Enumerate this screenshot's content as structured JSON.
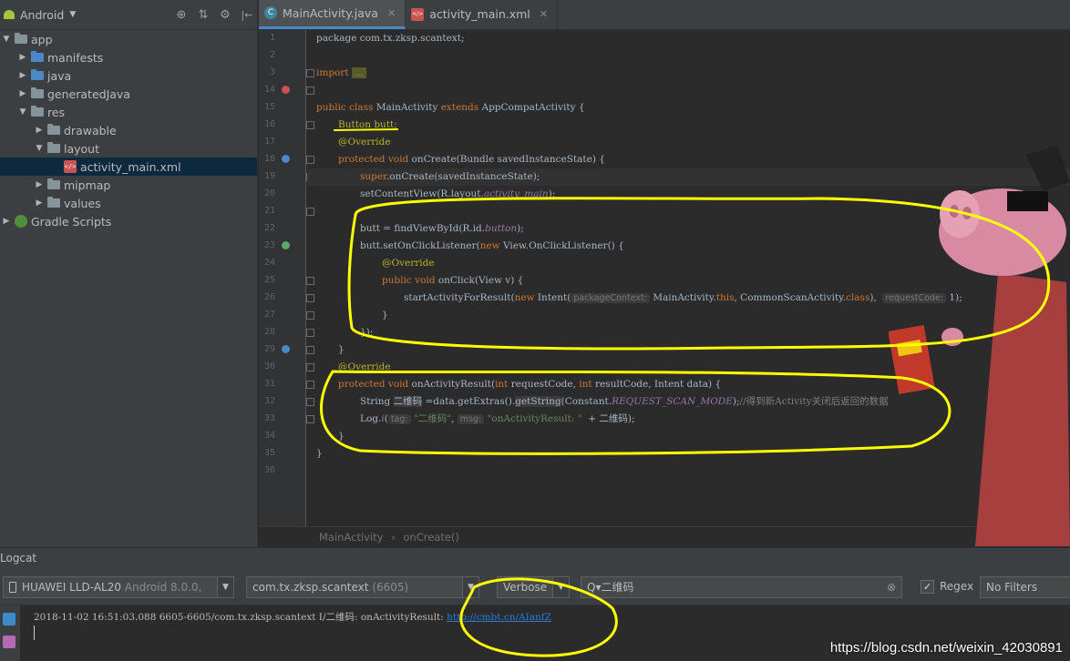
{
  "project": {
    "view_selector": "Android",
    "tree": [
      {
        "label": "app",
        "level": 0,
        "expanded": true,
        "icon": "app-folder-icon"
      },
      {
        "label": "manifests",
        "level": 1,
        "expanded": false,
        "icon": "folder-icon"
      },
      {
        "label": "java",
        "level": 1,
        "expanded": false,
        "icon": "folder-icon"
      },
      {
        "label": "generatedJava",
        "level": 1,
        "expanded": false,
        "icon": "folder-icon"
      },
      {
        "label": "res",
        "level": 1,
        "expanded": true,
        "icon": "folder-icon"
      },
      {
        "label": "drawable",
        "level": 2,
        "expanded": false,
        "icon": "folder-icon"
      },
      {
        "label": "layout",
        "level": 2,
        "expanded": true,
        "icon": "folder-icon"
      },
      {
        "label": "activity_main.xml",
        "level": 3,
        "selected": true,
        "icon": "xml-file-icon"
      },
      {
        "label": "mipmap",
        "level": 2,
        "expanded": false,
        "icon": "folder-icon"
      },
      {
        "label": "values",
        "level": 2,
        "expanded": false,
        "icon": "folder-icon"
      },
      {
        "label": "Gradle Scripts",
        "level": 0,
        "expanded": false,
        "icon": "gradle-icon"
      }
    ]
  },
  "editor": {
    "tabs": [
      {
        "label": "MainActivity.java",
        "active": true,
        "icon": "java-class-icon"
      },
      {
        "label": "activity_main.xml",
        "active": false,
        "icon": "xml-file-icon"
      }
    ],
    "line_numbers": [
      "1",
      "2",
      "3",
      "14",
      "15",
      "16",
      "17",
      "18",
      "19",
      "20",
      "21",
      "22",
      "23",
      "24",
      "25",
      "26",
      "27",
      "28",
      "29",
      "30",
      "31",
      "32",
      "33",
      "34",
      "35",
      "36"
    ],
    "breadcrumb": [
      "MainActivity",
      "onCreate()"
    ],
    "breadcrumb_sep": "›",
    "code": {
      "l1": "package com.tx.zksp.scantext;",
      "l3_kw": "import",
      "l3_fold": "...",
      "l15_a": "public class ",
      "l15_b": "MainActivity ",
      "l15_c": "extends ",
      "l15_d": "AppCompatActivity {",
      "l16": "Button butt;",
      "l17": "@Override",
      "l18_a": "protected void ",
      "l18_b": "onCreate(Bundle savedInstanceState) {",
      "l19_a": "super",
      "l19_b": ".onCreate(savedInstanceState);",
      "l20_a": "setContentView(R.layout.",
      "l20_b": "activity_main",
      "l20_c": ");",
      "l22_a": "butt = findViewById(R.id.",
      "l22_b": "button",
      "l22_c": ");",
      "l23_a": "butt.setOnClickListener(",
      "l23_b": "new ",
      "l23_c": "View.OnClickListener() {",
      "l24": "@Override",
      "l25_a": "public void ",
      "l25_b": "onClick(View v) {",
      "l26_a": "startActivityForResult(",
      "l26_b": "new ",
      "l26_c": "Intent(",
      "l26_hint1": "packageContext:",
      "l26_d": " MainActivity.",
      "l26_e": "this",
      "l26_f": ", CommonScanActivity.",
      "l26_g": "class",
      "l26_h": "),  ",
      "l26_hint2": "requestCode:",
      "l26_i": " 1);",
      "l27": "}",
      "l28": "});",
      "l29": "}",
      "l30": "@Override",
      "l31_a": "protected void ",
      "l31_b": "onActivityResult(",
      "l31_c": "int ",
      "l31_d": "requestCode, ",
      "l31_e": "int ",
      "l31_f": "resultCode, Intent data) {",
      "l32_a": "String ",
      "l32_b": "二维码",
      "l32_c": " =data.getExtras().",
      "l32_d": "getString",
      "l32_e": "(Constant.",
      "l32_f": "REQUEST_SCAN_MODE",
      "l32_g": ");",
      "l32_h": "//得到新Activity关闭后返回的数据",
      "l33_a": "Log.",
      "l33_b": "i",
      "l33_c": "(",
      "l33_hint1": "tag:",
      "l33_d": " \"二维码\"",
      "l33_e": ", ",
      "l33_hint2": "msg:",
      "l33_f": " \"onActivityResult: \"",
      "l33_g": "  + 二维码);",
      "l34": "}",
      "l35": "}"
    }
  },
  "logcat": {
    "title": "Logcat",
    "device": "HUAWEI LLD-AL20",
    "device_os": " Android 8.0.0,",
    "process": "com.tx.zksp.scantext",
    "process_pid": " (6605)",
    "level": "Verbose",
    "search_value": "二维码",
    "regex_label": "Regex",
    "regex_checked": true,
    "filter": "No Filters",
    "log_prefix": "2018-11-02 16:51:03.088 6605-6605/com.tx.zksp.scantext I/二维码: onActivityResult: ",
    "log_link": "http://cmbt.cn/AIanfZ"
  },
  "watermark": "https://blog.csdn.net/weixin_42030891",
  "colors": {
    "background": "#2b2b2b",
    "panel": "#3c3f41",
    "keyword": "#cc7832",
    "annotation": "#bbb529",
    "field": "#9876aa",
    "string": "#6a8759",
    "link": "#287bde",
    "highlight_marker": "#ffff00"
  }
}
